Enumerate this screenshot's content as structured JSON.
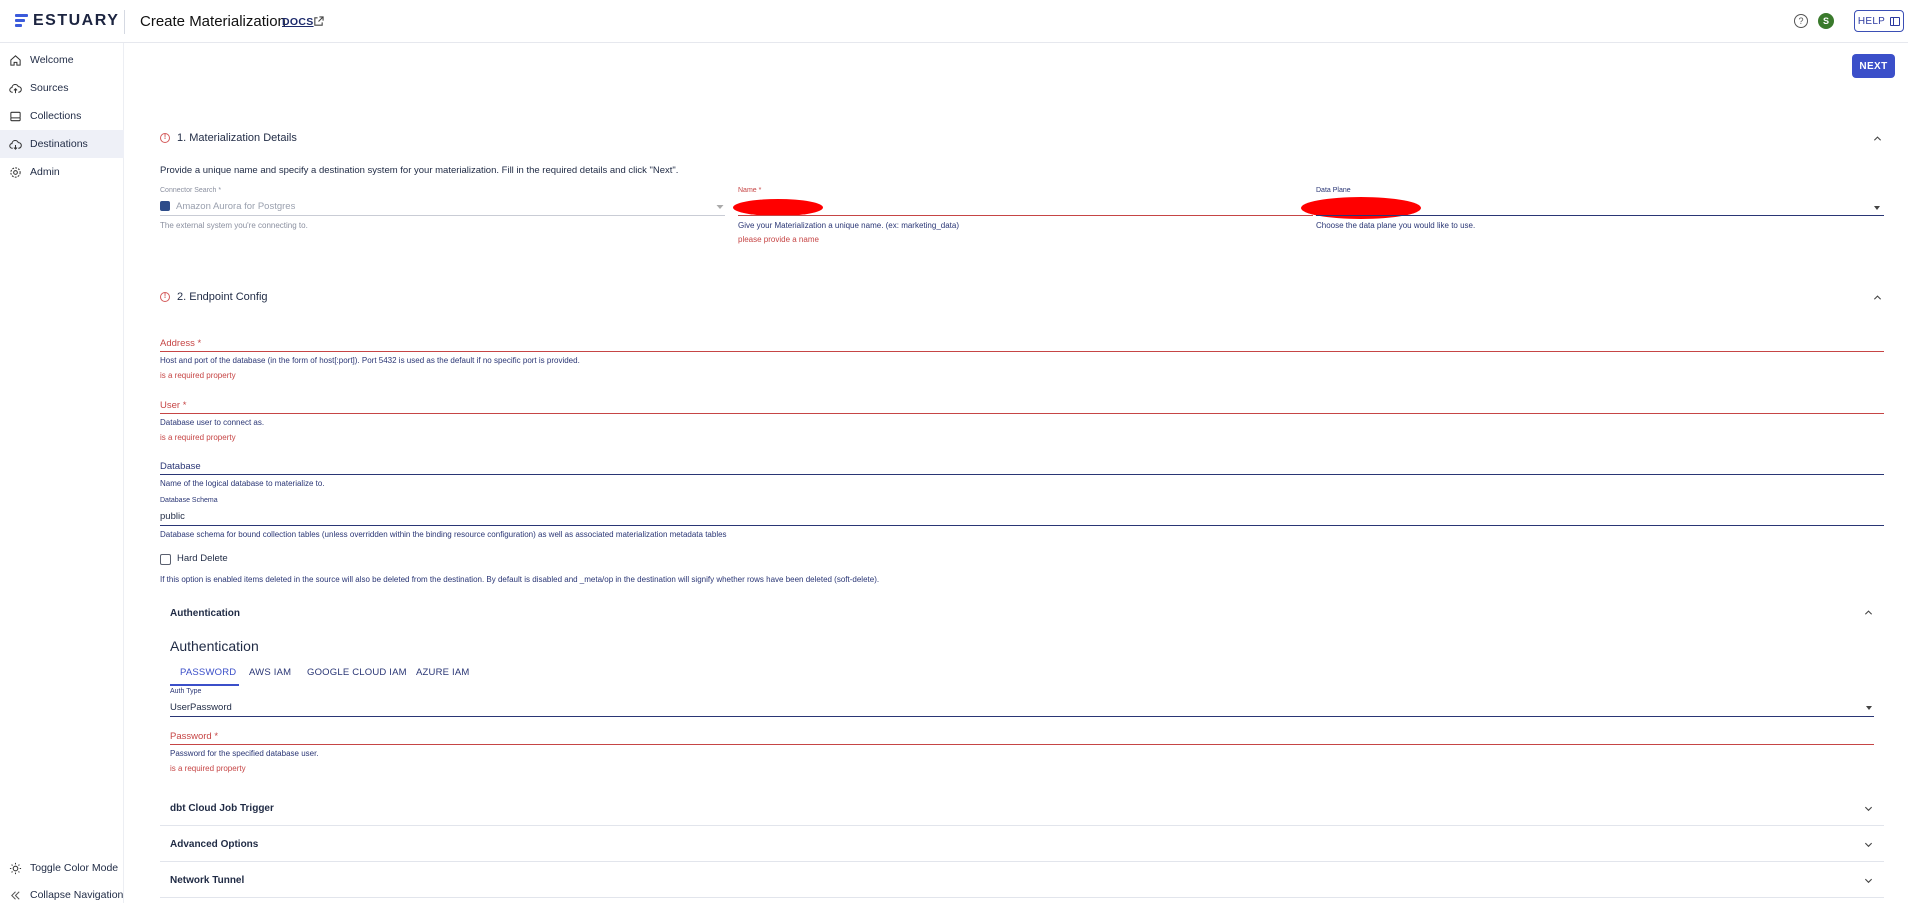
{
  "header": {
    "logo_text": "ESTUARY",
    "page_title": "Create Materialization",
    "docs_label": "DOCS",
    "avatar_initial": "S",
    "help_label": "HELP",
    "help_icon": "?"
  },
  "sidebar": {
    "items": [
      {
        "label": "Welcome",
        "icon": "home-icon"
      },
      {
        "label": "Sources",
        "icon": "cloud-upload-icon"
      },
      {
        "label": "Collections",
        "icon": "database-icon"
      },
      {
        "label": "Destinations",
        "icon": "cloud-download-icon"
      },
      {
        "label": "Admin",
        "icon": "gear-icon"
      }
    ],
    "toggle_color_mode": "Toggle Color Mode",
    "collapse_navigation": "Collapse Navigation"
  },
  "toolbar": {
    "next_label": "NEXT"
  },
  "details": {
    "title": "1. Materialization Details",
    "description": "Provide a unique name and specify a destination system for your materialization. Fill in the required details and click \"Next\".",
    "connector_label": "Connector Search *",
    "connector_value": "Amazon Aurora for Postgres",
    "connector_help": "The external system you're connecting to.",
    "name_label": "Name *",
    "name_help": "Give your Materialization a unique name. (ex: marketing_data)",
    "name_error": "please provide a name",
    "dataplane_label": "Data Plane",
    "dataplane_help": "Choose the data plane you would like to use."
  },
  "endpoint": {
    "title": "2. Endpoint Config",
    "address_label": "Address *",
    "address_help": "Host and port of the database (in the form of host[:port]). Port 5432 is used as the default if no specific port is provided.",
    "address_error": "is a required property",
    "user_label": "User *",
    "user_help": "Database user to connect as.",
    "user_error": "is a required property",
    "database_label": "Database",
    "database_help": "Name of the logical database to materialize to.",
    "schema_label": "Database Schema",
    "schema_value": "public",
    "schema_help": "Database schema for bound collection tables (unless overridden within the binding resource configuration) as well as associated materialization metadata tables",
    "hard_delete_label": "Hard Delete",
    "hard_delete_help": "If this option is enabled items deleted in the source will also be deleted from the destination. By default is disabled and _meta/op in the destination will signify whether rows have been deleted (soft-delete)."
  },
  "auth": {
    "accordion_title": "Authentication",
    "heading": "Authentication",
    "tabs": [
      "PASSWORD",
      "AWS IAM",
      "GOOGLE CLOUD IAM",
      "AZURE IAM"
    ],
    "auth_type_label": "Auth Type",
    "auth_type_value": "UserPassword",
    "password_label": "Password *",
    "password_help": "Password for the specified database user.",
    "password_error": "is a required property"
  },
  "accordions": [
    "dbt Cloud Job Trigger",
    "Advanced Options",
    "Network Tunnel"
  ],
  "colors": {
    "accent": "#3b4fc9",
    "error": "#c64545",
    "redaction": "#ff0000"
  }
}
